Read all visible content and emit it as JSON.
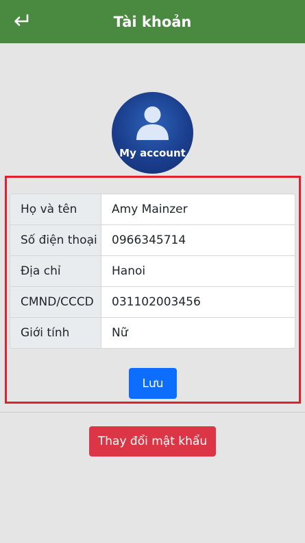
{
  "header": {
    "title": "Tài khoản",
    "back_icon": "return-arrow-icon",
    "background_color": "#4a8a40"
  },
  "avatar": {
    "label": "My account",
    "icon": "user-silhouette-icon"
  },
  "form": {
    "rows": [
      {
        "label": "Họ và tên",
        "value": "Amy Mainzer"
      },
      {
        "label": "Số điện thoại",
        "value": "0966345714"
      },
      {
        "label": "Địa chỉ",
        "value": "Hanoi"
      },
      {
        "label": "CMND/CCCD",
        "value": "031102003456"
      },
      {
        "label": "Giới tính",
        "value": "Nữ"
      }
    ],
    "highlight_color": "#e0202a"
  },
  "actions": {
    "save_label": "Lưu",
    "save_color": "#0d6efd",
    "change_password_label": "Thay đổi mật khẩu",
    "change_password_color": "#dc3545"
  }
}
